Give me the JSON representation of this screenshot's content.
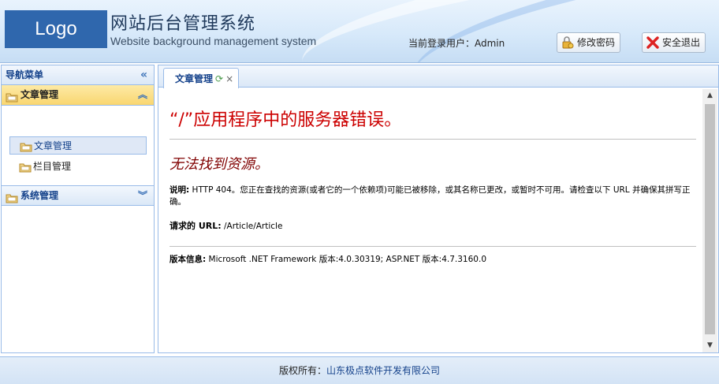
{
  "header": {
    "logo_text": "Logo",
    "title": "网站后台管理系统",
    "subtitle": "Website background management system",
    "login_label": "当前登录用户：Admin",
    "change_password_label": "修改密码",
    "logout_label": "安全退出"
  },
  "sidebar": {
    "title": "导航菜单",
    "collapse_icon": "«",
    "panels": [
      {
        "label": "文章管理",
        "arrow": "︽",
        "items": [
          {
            "label": "文章管理"
          },
          {
            "label": "栏目管理"
          }
        ]
      },
      {
        "label": "系统管理",
        "arrow": "︾"
      }
    ]
  },
  "tabs": [
    {
      "label": "文章管理",
      "refresh_icon": "⟳",
      "close_icon": "×"
    }
  ],
  "error_page": {
    "title": "“/”应用程序中的服务器错误。",
    "subtitle": "无法找到资源。",
    "description_label": "说明:",
    "description_text": "HTTP 404。您正在查找的资源(或者它的一个依赖项)可能已被移除，或其名称已更改，或暂时不可用。请检查以下 URL 并确保其拼写正确。",
    "url_label": "请求的 URL:",
    "url_value": "/Article/Article",
    "version_label": "版本信息:",
    "version_text": "Microsoft .NET Framework 版本:4.0.30319; ASP.NET 版本:4.7.3160.0"
  },
  "footer": {
    "copyright_label": "版权所有：",
    "company": "山东极点软件开发有限公司"
  },
  "colors": {
    "logo_bg": "#2f67ad",
    "error_title": "#cc0000",
    "error_subtitle": "#800000",
    "accent_border": "#99bbe8",
    "active_panel": "#f9d670"
  }
}
